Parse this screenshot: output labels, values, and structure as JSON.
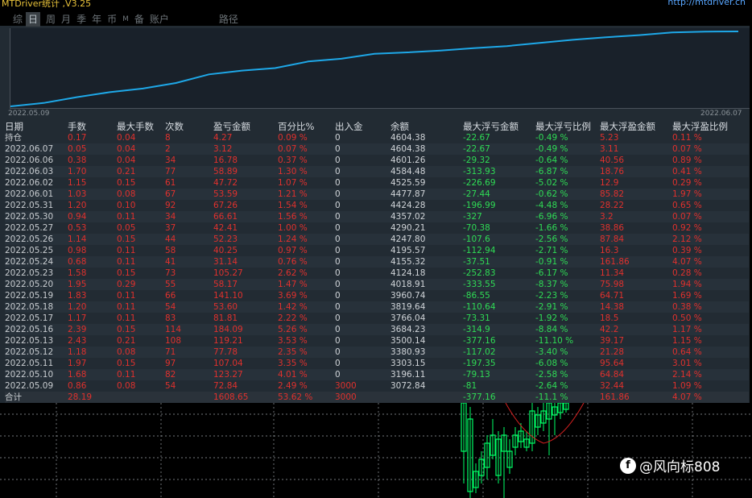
{
  "app": {
    "title": "MTDriver统计 ,V3.25",
    "link": "http://mtdriver.cn"
  },
  "tabs": [
    {
      "label": "综",
      "active": false,
      "small": false
    },
    {
      "label": "日",
      "active": true,
      "small": false
    },
    {
      "label": "周",
      "active": false,
      "small": false
    },
    {
      "label": "月",
      "active": false,
      "small": false
    },
    {
      "label": "季",
      "active": false,
      "small": false
    },
    {
      "label": "年",
      "active": false,
      "small": false
    },
    {
      "label": "币",
      "active": false,
      "small": false
    },
    {
      "label": "M",
      "active": false,
      "small": true
    },
    {
      "label": "备",
      "active": false,
      "small": false
    },
    {
      "label": "账户",
      "active": false,
      "small": false
    }
  ],
  "path_tab": "路径",
  "curve": {
    "start_date": "2022.05.09",
    "end_date": "2022.06.07",
    "line_color": "#1ea8e8"
  },
  "table": {
    "headers": [
      "日期",
      "手数",
      "最大手数",
      "次数",
      "盈亏金额",
      "百分比%",
      "出入金",
      "余额",
      "最大浮亏金额",
      "最大浮亏比例",
      "最大浮盈金额",
      "最大浮盈比例"
    ],
    "rows": [
      [
        "持仓",
        "0.17",
        "0.04",
        "8",
        "4.27",
        "0.09 %",
        "0",
        "4604.38",
        "-22.67",
        "-0.49 %",
        "5.23",
        "0.11 %"
      ],
      [
        "2022.06.07",
        "0.05",
        "0.04",
        "2",
        "3.12",
        "0.07 %",
        "0",
        "4604.38",
        "-22.67",
        "-0.49 %",
        "3.11",
        "0.07 %"
      ],
      [
        "2022.06.06",
        "0.38",
        "0.04",
        "34",
        "16.78",
        "0.37 %",
        "0",
        "4601.26",
        "-29.32",
        "-0.64 %",
        "40.56",
        "0.89 %"
      ],
      [
        "2022.06.03",
        "1.70",
        "0.21",
        "77",
        "58.89",
        "1.30 %",
        "0",
        "4584.48",
        "-313.93",
        "-6.87 %",
        "18.76",
        "0.41 %"
      ],
      [
        "2022.06.02",
        "1.15",
        "0.15",
        "61",
        "47.72",
        "1.07 %",
        "0",
        "4525.59",
        "-226.69",
        "-5.02 %",
        "12.9",
        "0.29 %"
      ],
      [
        "2022.06.01",
        "1.03",
        "0.08",
        "67",
        "53.59",
        "1.21 %",
        "0",
        "4477.87",
        "-27.44",
        "-0.62 %",
        "85.82",
        "1.97 %"
      ],
      [
        "2022.05.31",
        "1.20",
        "0.10",
        "92",
        "67.26",
        "1.54 %",
        "0",
        "4424.28",
        "-196.99",
        "-4.48 %",
        "28.22",
        "0.65 %"
      ],
      [
        "2022.05.30",
        "0.94",
        "0.11",
        "34",
        "66.61",
        "1.56 %",
        "0",
        "4357.02",
        "-327",
        "-6.96 %",
        "3.2",
        "0.07 %"
      ],
      [
        "2022.05.27",
        "0.53",
        "0.05",
        "37",
        "42.41",
        "1.00 %",
        "0",
        "4290.21",
        "-70.38",
        "-1.66 %",
        "38.86",
        "0.92 %"
      ],
      [
        "2022.05.26",
        "1.14",
        "0.15",
        "44",
        "52.23",
        "1.24 %",
        "0",
        "4247.80",
        "-107.6",
        "-2.56 %",
        "87.84",
        "2.12 %"
      ],
      [
        "2022.05.25",
        "0.98",
        "0.11",
        "58",
        "40.25",
        "0.97 %",
        "0",
        "4195.57",
        "-112.94",
        "-2.71 %",
        "16.3",
        "0.39 %"
      ],
      [
        "2022.05.24",
        "0.68",
        "0.11",
        "41",
        "31.14",
        "0.76 %",
        "0",
        "4155.32",
        "-37.51",
        "-0.91 %",
        "161.86",
        "4.07 %"
      ],
      [
        "2022.05.23",
        "1.58",
        "0.15",
        "73",
        "105.27",
        "2.62 %",
        "0",
        "4124.18",
        "-252.83",
        "-6.17 %",
        "11.34",
        "0.28 %"
      ],
      [
        "2022.05.20",
        "1.95",
        "0.29",
        "55",
        "58.17",
        "1.47 %",
        "0",
        "4018.91",
        "-333.55",
        "-8.37 %",
        "75.98",
        "1.94 %"
      ],
      [
        "2022.05.19",
        "1.83",
        "0.11",
        "66",
        "141.10",
        "3.69 %",
        "0",
        "3960.74",
        "-86.55",
        "-2.23 %",
        "64.71",
        "1.69 %"
      ],
      [
        "2022.05.18",
        "1.20",
        "0.11",
        "54",
        "53.60",
        "1.42 %",
        "0",
        "3819.64",
        "-110.64",
        "-2.91 %",
        "14.38",
        "0.38 %"
      ],
      [
        "2022.05.17",
        "1.17",
        "0.11",
        "83",
        "81.81",
        "2.22 %",
        "0",
        "3766.04",
        "-73.31",
        "-1.92 %",
        "18.5",
        "0.50 %"
      ],
      [
        "2022.05.16",
        "2.39",
        "0.15",
        "114",
        "184.09",
        "5.26 %",
        "0",
        "3684.23",
        "-314.9",
        "-8.84 %",
        "42.2",
        "1.17 %"
      ],
      [
        "2022.05.13",
        "2.43",
        "0.21",
        "108",
        "119.21",
        "3.53 %",
        "0",
        "3500.14",
        "-377.16",
        "-11.10 %",
        "39.17",
        "1.15 %"
      ],
      [
        "2022.05.12",
        "1.18",
        "0.08",
        "71",
        "77.78",
        "2.35 %",
        "0",
        "3380.93",
        "-117.02",
        "-3.40 %",
        "21.28",
        "0.64 %"
      ],
      [
        "2022.05.11",
        "1.97",
        "0.15",
        "97",
        "107.04",
        "3.35 %",
        "0",
        "3303.15",
        "-197.35",
        "-6.08 %",
        "95.64",
        "3.01 %"
      ],
      [
        "2022.05.10",
        "1.68",
        "0.11",
        "82",
        "123.27",
        "4.01 %",
        "0",
        "3196.11",
        "-79.13",
        "-2.58 %",
        "64.84",
        "2.14 %"
      ],
      [
        "2022.05.09",
        "0.86",
        "0.08",
        "54",
        "72.84",
        "2.49 %",
        "3000",
        "3072.84",
        "-81",
        "-2.64 %",
        "32.44",
        "1.09 %"
      ]
    ],
    "total": [
      "合计",
      "28.19",
      "",
      "",
      "1608.65",
      "53.62 %",
      "3000",
      "",
      "-377.16",
      "-11.1 %",
      "161.86",
      "4.07 %"
    ]
  },
  "watermark": {
    "icon": "weibo-like-f-icon",
    "text": "@风向标808"
  },
  "colors": {
    "red": "#e0312d",
    "green": "#2fdc55",
    "panel": "#222b33",
    "candle": "#00ff66",
    "ma": "#d42020"
  }
}
